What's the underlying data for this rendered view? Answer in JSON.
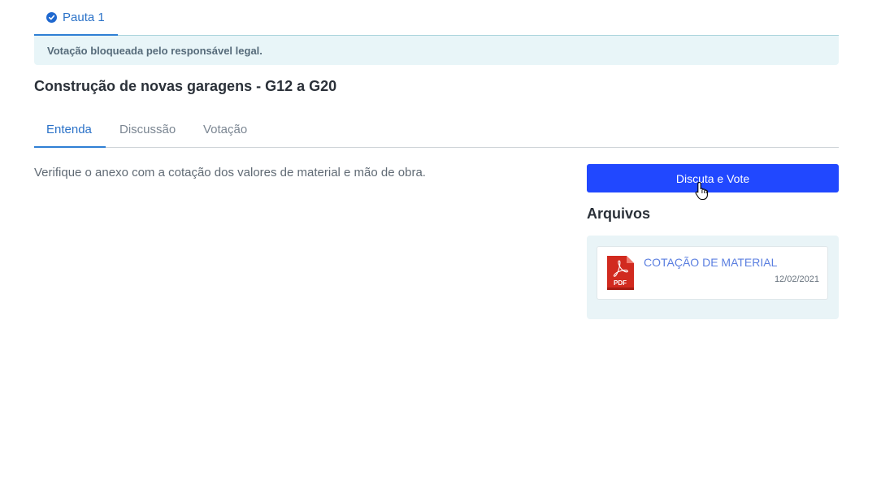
{
  "pauta_tab": {
    "label": "Pauta 1",
    "icon": "check-circle-icon"
  },
  "alert": {
    "text": "Votação bloqueada pelo responsável legal."
  },
  "title": "Construção de novas garagens - G12 a G20",
  "tabs": [
    {
      "label": "Entenda",
      "active": true
    },
    {
      "label": "Discussão",
      "active": false
    },
    {
      "label": "Votação",
      "active": false
    }
  ],
  "description": "Verifique o anexo com a cotação dos valores de material e mão de obra.",
  "vote_button": {
    "label": "Discuta e Vote",
    "color": "#2148ff"
  },
  "files": {
    "heading": "Arquivos",
    "items": [
      {
        "name": "COTAÇÃO DE MATERIAL",
        "date": "12/02/2021",
        "icon": "pdf-file-icon",
        "icon_label": "PDF"
      }
    ]
  },
  "colors": {
    "accent": "#2f7fd4",
    "alert_bg": "#e8f5f8",
    "panel_bg": "#e9f4f7",
    "pdf_red": "#d12a1f"
  }
}
